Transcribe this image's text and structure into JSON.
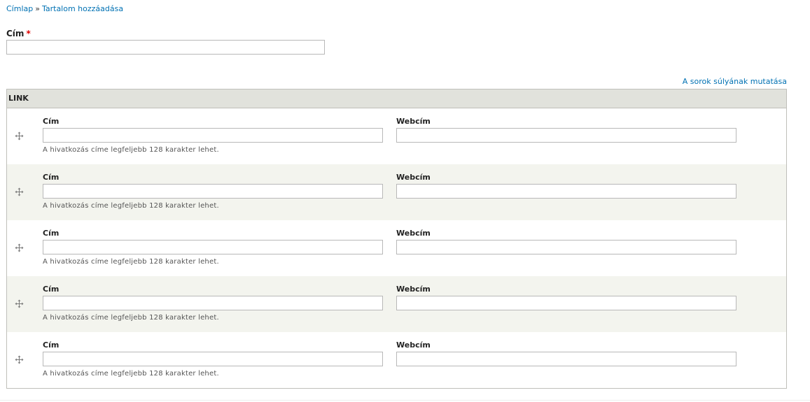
{
  "breadcrumb": {
    "home": "Címlap",
    "separator": "»",
    "current": "Tartalom hozzáadása"
  },
  "title_field": {
    "label": "Cím",
    "required_mark": "*",
    "value": ""
  },
  "weight_toggle": "A sorok súlyának mutatása",
  "link_table": {
    "header": "LINK",
    "drag_icon": "move-cross-icon",
    "rows": [
      {
        "title_label": "Cím",
        "title_value": "",
        "url_label": "Webcím",
        "url_value": "",
        "description": "A hivatkozás címe legfeljebb 128 karakter lehet."
      },
      {
        "title_label": "Cím",
        "title_value": "",
        "url_label": "Webcím",
        "url_value": "",
        "description": "A hivatkozás címe legfeljebb 128 karakter lehet."
      },
      {
        "title_label": "Cím",
        "title_value": "",
        "url_label": "Webcím",
        "url_value": "",
        "description": "A hivatkozás címe legfeljebb 128 karakter lehet."
      },
      {
        "title_label": "Cím",
        "title_value": "",
        "url_label": "Webcím",
        "url_value": "",
        "description": "A hivatkozás címe legfeljebb 128 karakter lehet."
      },
      {
        "title_label": "Cím",
        "title_value": "",
        "url_label": "Webcím",
        "url_value": "",
        "description": "A hivatkozás címe legfeljebb 128 karakter lehet."
      }
    ]
  },
  "colors": {
    "link": "#0071b3",
    "required": "#e00000",
    "header_bg": "#e1e2dc",
    "even_row_bg": "#f3f4ee",
    "border": "#bfbfba"
  }
}
